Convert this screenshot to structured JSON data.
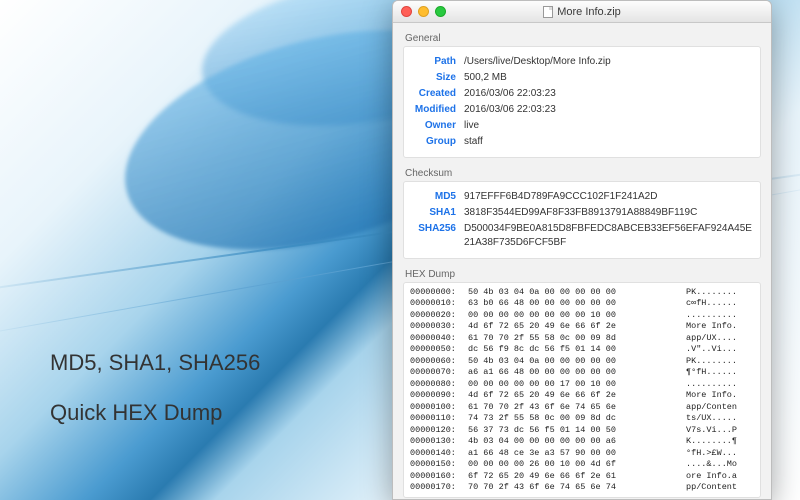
{
  "promo": {
    "line1": "MD5, SHA1, SHA256",
    "line2": "Quick HEX Dump"
  },
  "window": {
    "title": "More Info.zip"
  },
  "general": {
    "section": "General",
    "labels": {
      "path": "Path",
      "size": "Size",
      "created": "Created",
      "modified": "Modified",
      "owner": "Owner",
      "group": "Group"
    },
    "values": {
      "path": "/Users/live/Desktop/More Info.zip",
      "size": "500,2 MB",
      "created": "2016/03/06 22:03:23",
      "modified": "2016/03/06 22:03:23",
      "owner": "live",
      "group": "staff"
    }
  },
  "checksum": {
    "section": "Checksum",
    "labels": {
      "md5": "MD5",
      "sha1": "SHA1",
      "sha256": "SHA256"
    },
    "values": {
      "md5": "917EFFF6B4D789FA9CCC102F1F241A2D",
      "sha1": "3818F3544ED99AF8F33FB8913791A88849BF119C",
      "sha256": "D500034F9BE0A815D8FBFEDC8ABCEB33EF56EFAF924A45E21A38F735D6FCF5BF"
    }
  },
  "hex": {
    "section": "HEX Dump",
    "rows": [
      {
        "offset": "00000000:",
        "bytes": "50 4b 03 04 0a 00 00 00 00 00",
        "ascii": "PK........"
      },
      {
        "offset": "00000010:",
        "bytes": "63 b0 66 48 00 00 00 00 00 00",
        "ascii": "c∞fH......"
      },
      {
        "offset": "00000020:",
        "bytes": "00 00 00 00 00 00 00 00 10 00",
        "ascii": ".........."
      },
      {
        "offset": "00000030:",
        "bytes": "4d 6f 72 65 20 49 6e 66 6f 2e",
        "ascii": "More Info."
      },
      {
        "offset": "00000040:",
        "bytes": "61 70 70 2f 55 58 0c 00 09 8d",
        "ascii": "app/UX...."
      },
      {
        "offset": "00000050:",
        "bytes": "dc 56 f9 8c dc 56 f5 01 14 00",
        "ascii": ".V\"..Vi..."
      },
      {
        "offset": "00000060:",
        "bytes": "50 4b 03 04 0a 00 00 00 00 00",
        "ascii": "PK........"
      },
      {
        "offset": "00000070:",
        "bytes": "a6 a1 66 48 00 00 00 00 00 00",
        "ascii": "¶°fH......"
      },
      {
        "offset": "00000080:",
        "bytes": "00 00 00 00 00 00 17 00 10 00",
        "ascii": ".........."
      },
      {
        "offset": "00000090:",
        "bytes": "4d 6f 72 65 20 49 6e 66 6f 2e",
        "ascii": "More Info."
      },
      {
        "offset": "00000100:",
        "bytes": "61 70 70 2f 43 6f 6e 74 65 6e",
        "ascii": "app/Conten"
      },
      {
        "offset": "00000110:",
        "bytes": "74 73 2f 55 58 0c 00 09 8d dc",
        "ascii": "ts/UX....."
      },
      {
        "offset": "00000120:",
        "bytes": "56 37 73 dc 56 f5 01 14 00 50",
        "ascii": "V7s.Vi...P"
      },
      {
        "offset": "00000130:",
        "bytes": "4b 03 04 00 00 00 00 00 00 a6",
        "ascii": "K........¶"
      },
      {
        "offset": "00000140:",
        "bytes": "a1 66 48 ce 3e a3 57 90 00 00",
        "ascii": "°fH.>£W..."
      },
      {
        "offset": "00000150:",
        "bytes": "00 00 00 00 26 00 10 00 4d 6f",
        "ascii": "....&...Mo"
      },
      {
        "offset": "00000160:",
        "bytes": "6f 72 65 20 49 6e 66 6f 2e 61",
        "ascii": "ore Info.a"
      },
      {
        "offset": "00000170:",
        "bytes": "70 70 2f 43 6f 6e 74 65 6e 74",
        "ascii": "pp/Content"
      }
    ]
  }
}
